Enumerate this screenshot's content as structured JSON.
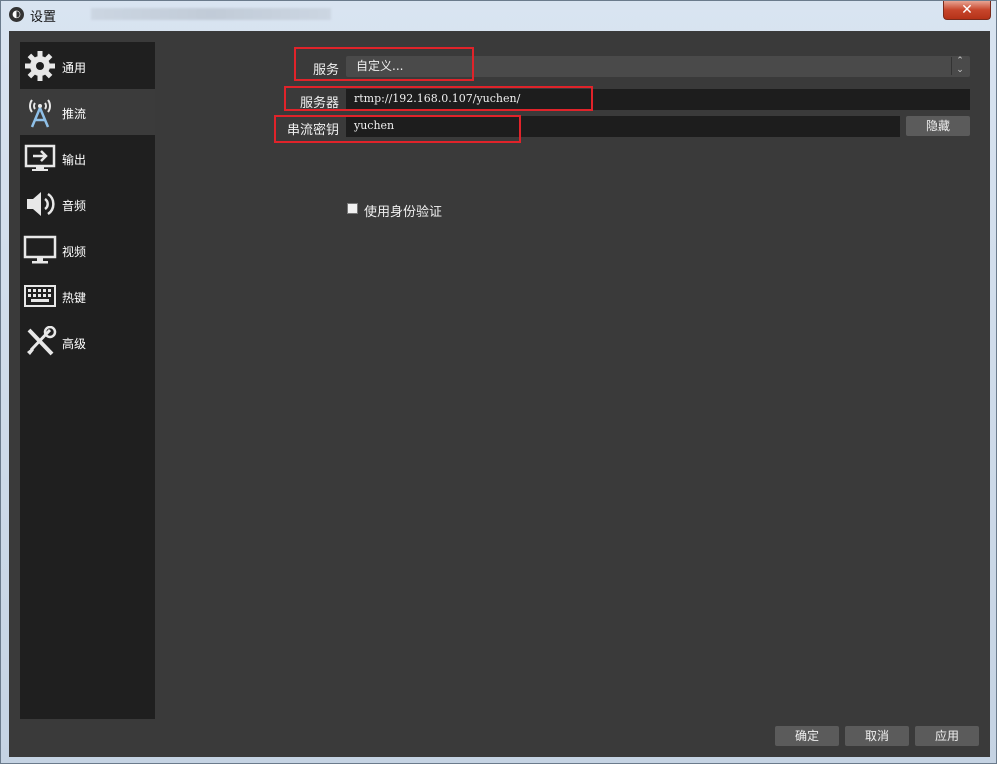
{
  "window": {
    "title": "设置",
    "close_glyph": "✕"
  },
  "sidebar": {
    "items": [
      {
        "label": "通用",
        "icon": "gear-icon"
      },
      {
        "label": "推流",
        "icon": "antenna-icon"
      },
      {
        "label": "输出",
        "icon": "output-icon"
      },
      {
        "label": "音频",
        "icon": "speaker-icon"
      },
      {
        "label": "视频",
        "icon": "monitor-icon"
      },
      {
        "label": "热键",
        "icon": "keyboard-icon"
      },
      {
        "label": "高级",
        "icon": "tools-icon"
      }
    ],
    "active_index": 1
  },
  "stream": {
    "service_label": "服务",
    "service_value": "自定义...",
    "server_label": "服务器",
    "server_value": "rtmp://192.168.0.107/yuchen/",
    "key_label": "串流密钥",
    "key_value": "yuchen",
    "hide_button": "隐藏",
    "auth_checkbox_label": "使用身份验证"
  },
  "footer": {
    "ok": "确定",
    "cancel": "取消",
    "apply": "应用"
  },
  "colors": {
    "panel_bg": "#3a3a3a",
    "sidebar_bg": "#1f1f1f",
    "highlight_box": "#e0232a"
  }
}
